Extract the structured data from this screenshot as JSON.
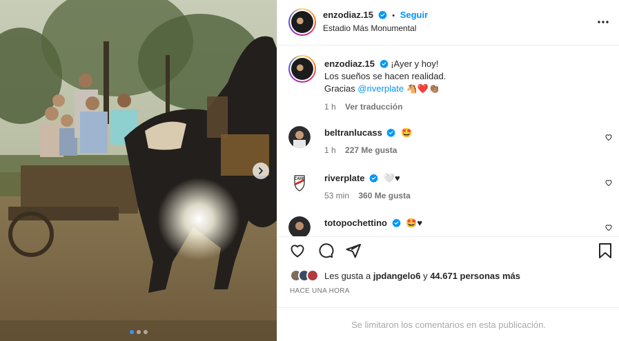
{
  "post": {
    "username": "enzodiaz.15",
    "separator": "•",
    "follow_label": "Seguir",
    "location": "Estadio Más Monumental",
    "more_icon": "more-horizontal-icon"
  },
  "caption": {
    "username": "enzodiaz.15",
    "line1": "¡Ayer y hoy!",
    "line2": "Los sueños se hacen realidad.",
    "line3_prefix": "Gracias ",
    "mention": "@riverplate",
    "emojis": "🐴❤️👏🏽",
    "time": "1 h",
    "translate": "Ver traducción"
  },
  "comments": [
    {
      "username": "beltranlucass",
      "text": "🤩",
      "time": "1 h",
      "likes": "227 Me gusta"
    },
    {
      "username": "riverplate",
      "text": "🤍♥",
      "time": "53 min",
      "likes": "360 Me gusta"
    },
    {
      "username": "totopochettino",
      "text": "🤩♥"
    }
  ],
  "likes": {
    "prefix": "Les gusta a ",
    "user": "jpdangelo6",
    "middle": " y ",
    "count": "44.671 personas más"
  },
  "timestamp": "HACE UNA HORA",
  "comments_limited": "Se limitaron los comentarios en esta publicación.",
  "colors": {
    "accent": "#0095f6",
    "verified": "#0095f6",
    "river_red": "#e1261c"
  },
  "carousel": {
    "total_slides": 3,
    "active_slide": 1
  }
}
